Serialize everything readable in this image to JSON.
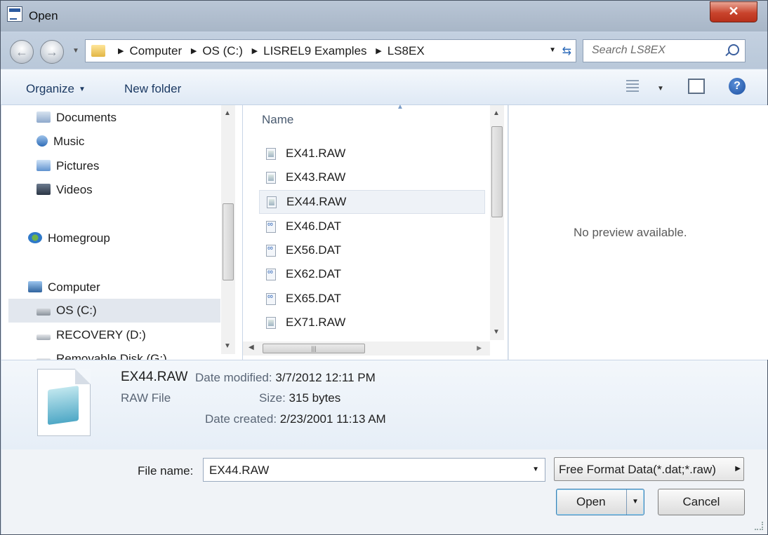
{
  "window": {
    "title": "Open",
    "close_glyph": "✕"
  },
  "address": {
    "crumbs": [
      "Computer",
      "OS (C:)",
      "LISREL9 Examples",
      "LS8EX"
    ]
  },
  "search": {
    "placeholder": "Search LS8EX"
  },
  "toolbar": {
    "organize": "Organize",
    "new_folder": "New folder"
  },
  "nav": {
    "items": [
      {
        "label": "Documents",
        "icon": "documents-icon"
      },
      {
        "label": "Music",
        "icon": "music-icon"
      },
      {
        "label": "Pictures",
        "icon": "pictures-icon"
      },
      {
        "label": "Videos",
        "icon": "videos-icon"
      },
      {
        "label": "Homegroup",
        "icon": "homegroup-icon"
      },
      {
        "label": "Computer",
        "icon": "computer-icon"
      },
      {
        "label": "OS (C:)",
        "icon": "drive-icon",
        "selected": true
      },
      {
        "label": "RECOVERY (D:)",
        "icon": "drive-icon"
      },
      {
        "label": "Removable Disk (G:)",
        "icon": "removable-icon"
      }
    ]
  },
  "files": {
    "column_name": "Name",
    "items": [
      {
        "name": "EX41.RAW",
        "type": "raw"
      },
      {
        "name": "EX43.RAW",
        "type": "raw"
      },
      {
        "name": "EX44.RAW",
        "type": "raw",
        "selected": true
      },
      {
        "name": "EX46.DAT",
        "type": "dat"
      },
      {
        "name": "EX56.DAT",
        "type": "dat"
      },
      {
        "name": "EX62.DAT",
        "type": "dat"
      },
      {
        "name": "EX65.DAT",
        "type": "dat"
      },
      {
        "name": "EX71.RAW",
        "type": "raw"
      }
    ]
  },
  "preview": {
    "text": "No preview available."
  },
  "details": {
    "filename": "EX44.RAW",
    "filetype": "RAW File",
    "modified_label": "Date modified:",
    "modified_value": "3/7/2012 12:11 PM",
    "size_label": "Size:",
    "size_value": "315 bytes",
    "created_label": "Date created:",
    "created_value": "2/23/2001 11:13 AM"
  },
  "bottom": {
    "filename_label": "File name:",
    "filename_value": "EX44.RAW",
    "filter": "Free Format Data(*.dat;*.raw)",
    "open": "Open",
    "cancel": "Cancel"
  }
}
